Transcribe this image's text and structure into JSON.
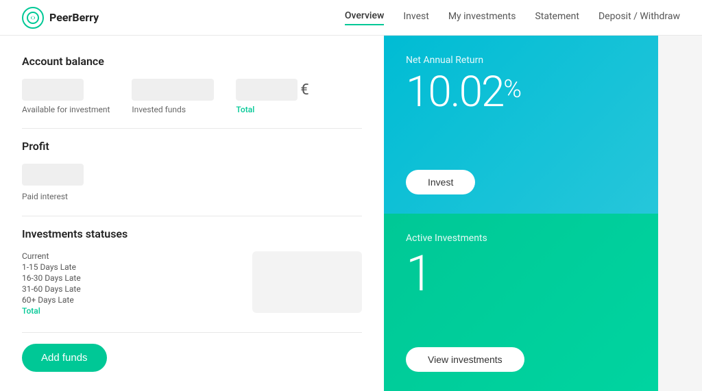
{
  "header": {
    "logo_text": "PeerBerry",
    "nav": [
      {
        "label": "Overview",
        "active": true
      },
      {
        "label": "Invest",
        "active": false
      },
      {
        "label": "My investments",
        "active": false
      },
      {
        "label": "Statement",
        "active": false
      },
      {
        "label": "Deposit / Withdraw",
        "active": false
      }
    ]
  },
  "account_balance": {
    "title": "Account balance",
    "items": [
      {
        "label": "Available for investment",
        "label_class": ""
      },
      {
        "label": "Invested funds",
        "label_class": ""
      },
      {
        "label": "Total",
        "label_class": "green"
      }
    ],
    "euro_sign": "€"
  },
  "profit": {
    "title": "Profit",
    "label": "Paid interest"
  },
  "investments_statuses": {
    "title": "Investments statuses",
    "items": [
      {
        "label": "Current",
        "class": ""
      },
      {
        "label": "1-15 Days Late",
        "class": ""
      },
      {
        "label": "16-30 Days Late",
        "class": ""
      },
      {
        "label": "31-60 Days Late",
        "class": ""
      },
      {
        "label": "60+ Days Late",
        "class": ""
      },
      {
        "label": "Total",
        "class": "green"
      }
    ]
  },
  "add_funds": {
    "label": "Add funds"
  },
  "nar_card": {
    "subtitle": "Net Annual Return",
    "value": "10.02",
    "percent": "%",
    "invest_button": "Invest"
  },
  "ai_card": {
    "subtitle": "Active Investments",
    "value": "1",
    "view_button": "View investments"
  }
}
